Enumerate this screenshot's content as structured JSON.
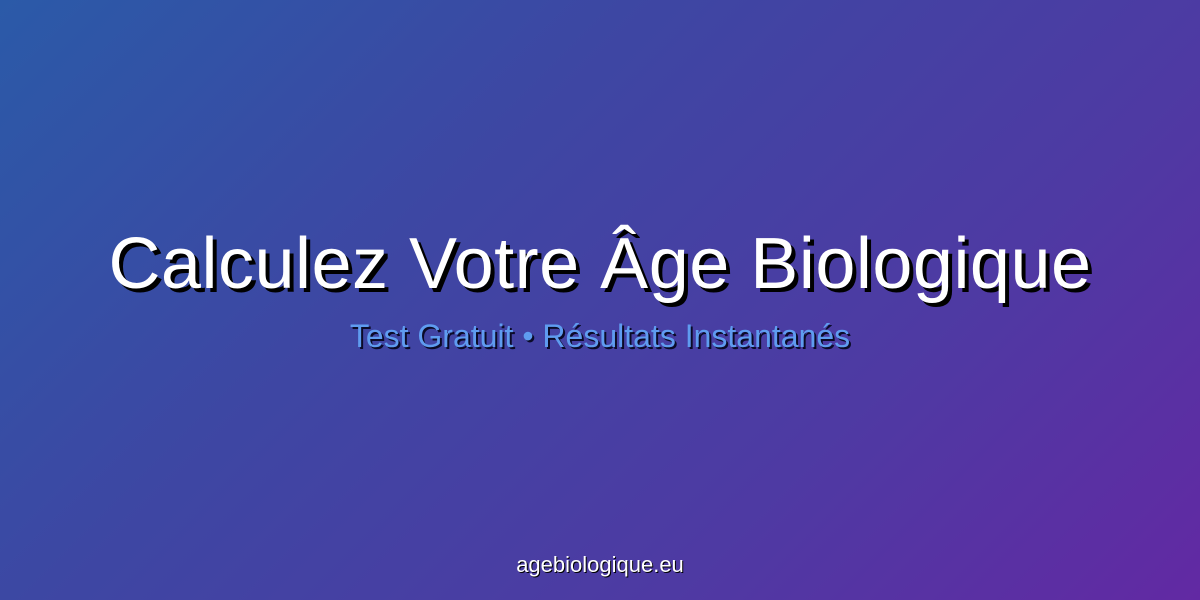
{
  "banner": {
    "headline": "Calculez Votre Âge Biologique",
    "subheadline": "Test Gratuit • Résultats Instantanés",
    "domain": "agebiologique.eu"
  },
  "colors": {
    "gradient_start": "#2b5aa8",
    "gradient_end": "#6229a3",
    "headline_text": "#ffffff",
    "subheadline_text": "#5f9cf0",
    "text_shadow": "#000000"
  }
}
